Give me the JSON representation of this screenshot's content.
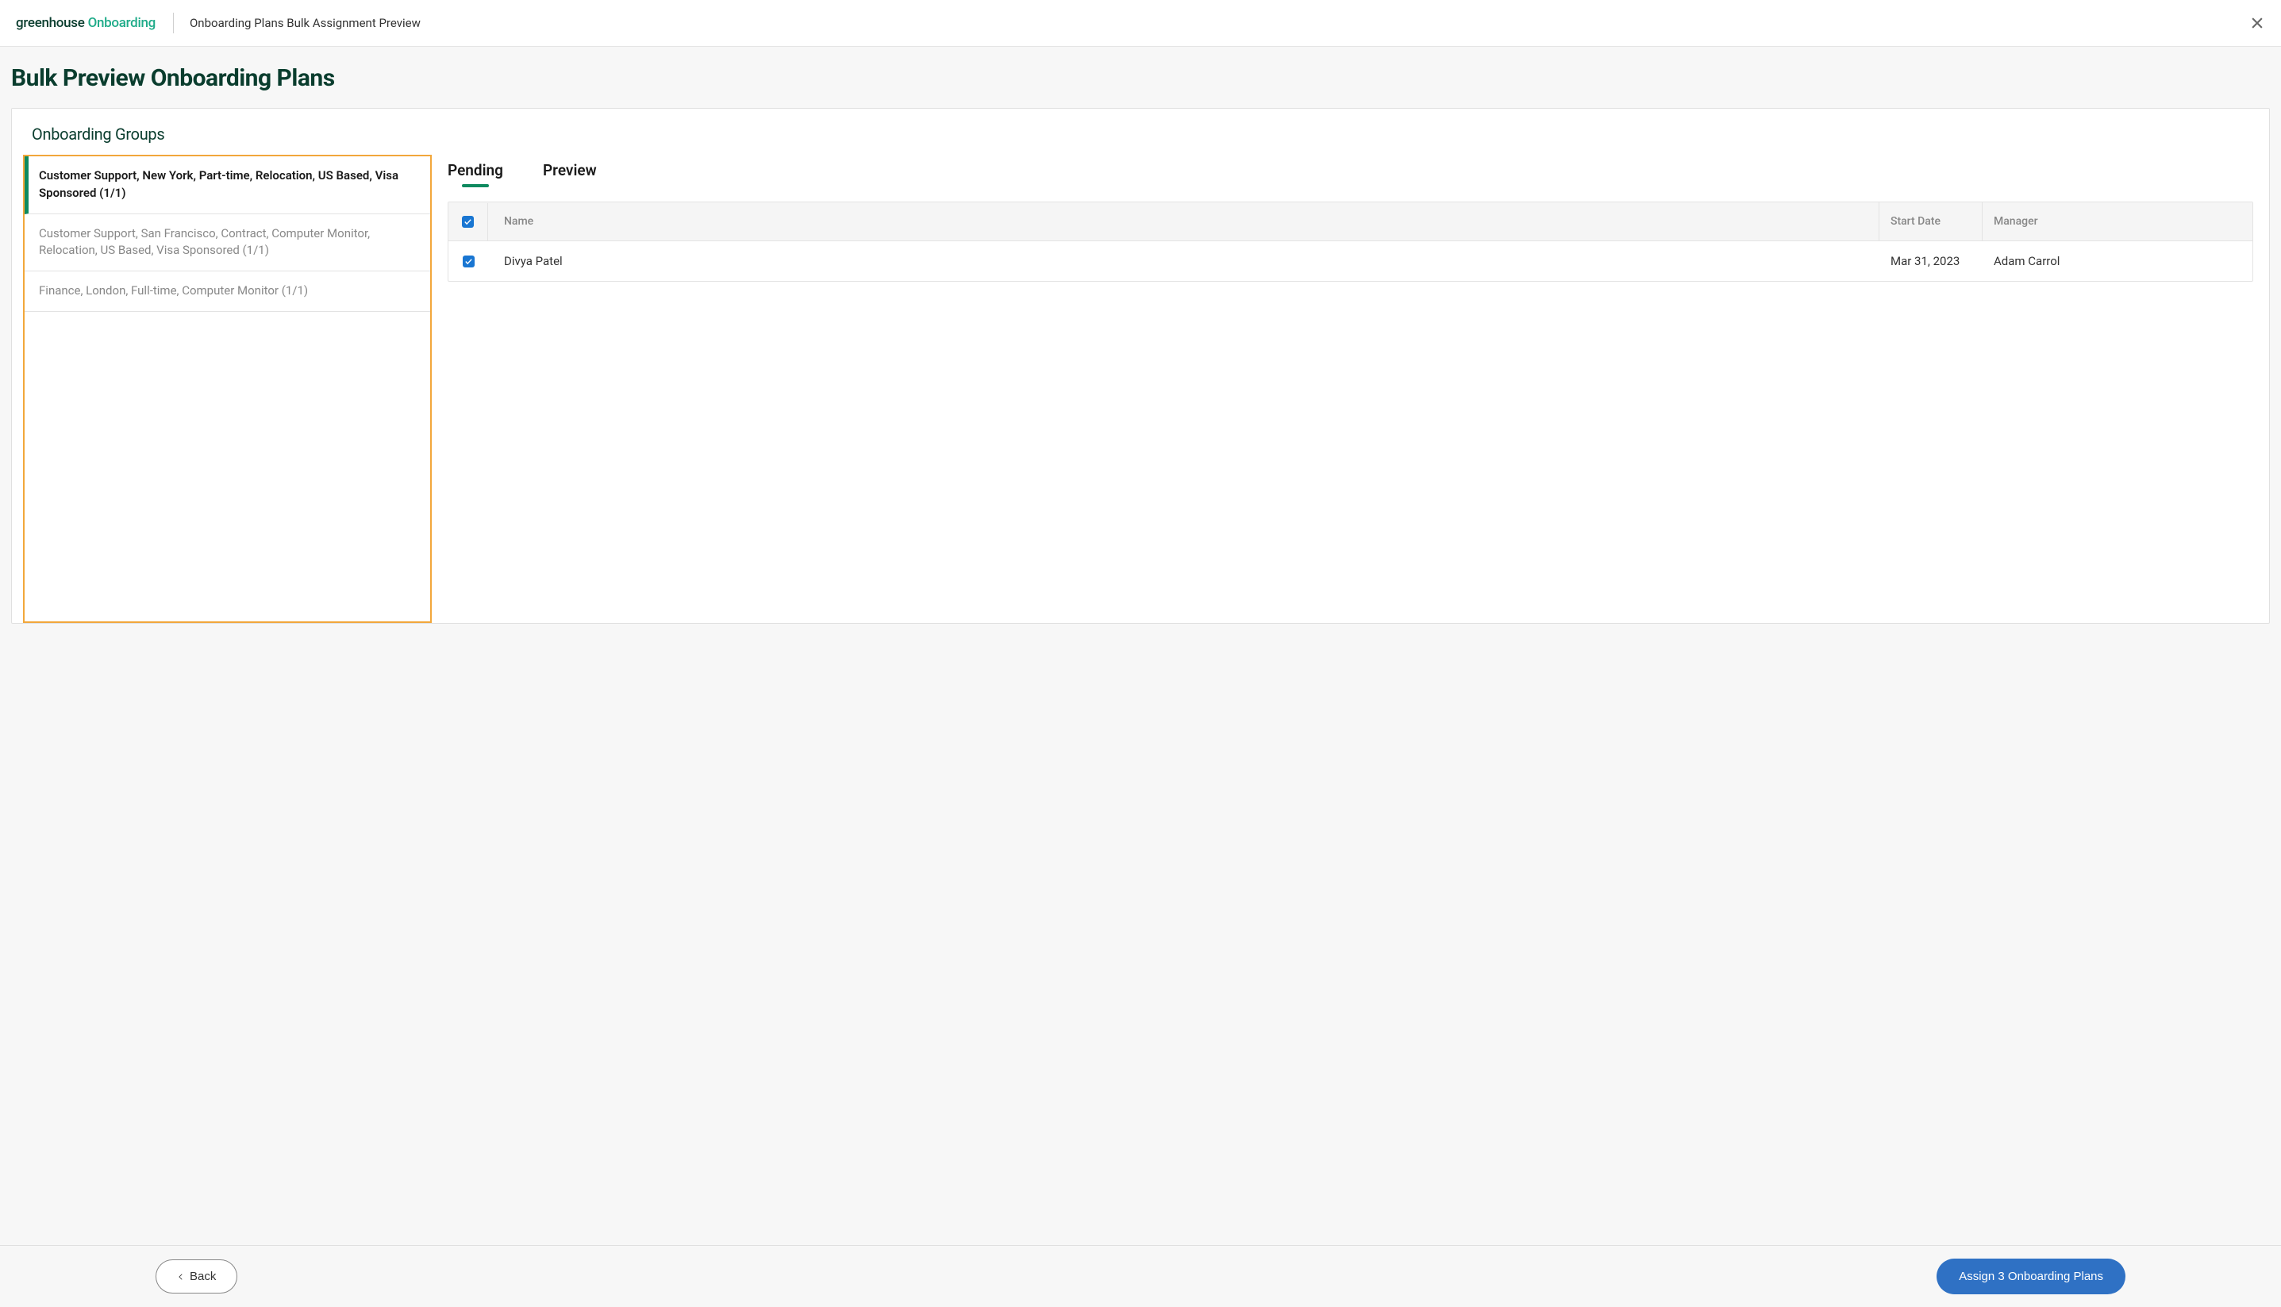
{
  "header": {
    "logo_part1": "greenhouse",
    "logo_part2": "Onboarding",
    "breadcrumb": "Onboarding Plans Bulk Assignment Preview"
  },
  "page_title": "Bulk Preview Onboarding Plans",
  "panel": {
    "title": "Onboarding Groups"
  },
  "groups": [
    {
      "label": "Customer Support, New York, Part-time, Relocation, US Based, Visa Sponsored (1/1)",
      "active": true
    },
    {
      "label": "Customer Support, San Francisco, Contract, Computer Monitor, Relocation, US Based, Visa Sponsored (1/1)",
      "active": false
    },
    {
      "label": "Finance, London, Full-time, Computer Monitor (1/1)",
      "active": false
    }
  ],
  "tabs": [
    {
      "label": "Pending",
      "active": true
    },
    {
      "label": "Preview",
      "active": false
    }
  ],
  "table": {
    "headers": {
      "name": "Name",
      "start_date": "Start Date",
      "manager": "Manager"
    },
    "rows": [
      {
        "checked": true,
        "name": "Divya Patel",
        "start_date": "Mar 31, 2023",
        "manager": "Adam Carrol"
      }
    ]
  },
  "footer": {
    "back_label": "Back",
    "assign_label": "Assign 3 Onboarding Plans"
  }
}
